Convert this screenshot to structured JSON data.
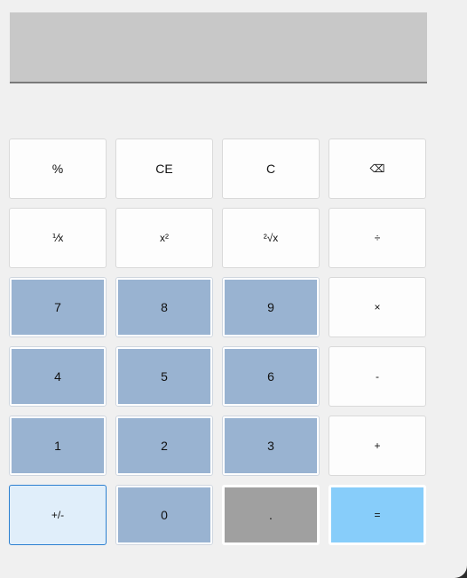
{
  "display": {
    "value": ""
  },
  "keys": [
    {
      "label": "%",
      "name": "percent-button"
    },
    {
      "label": "CE",
      "name": "clear-entry-button"
    },
    {
      "label": "C",
      "name": "clear-button"
    },
    {
      "label": "⌫",
      "name": "backspace-button",
      "icon": "backspace-icon"
    },
    {
      "label": "⅟x",
      "name": "reciprocal-button"
    },
    {
      "label": "x²",
      "name": "square-button"
    },
    {
      "label": "²√x",
      "name": "square-root-button"
    },
    {
      "label": "÷",
      "name": "divide-button"
    },
    {
      "label": "7",
      "name": "digit-7-button"
    },
    {
      "label": "8",
      "name": "digit-8-button"
    },
    {
      "label": "9",
      "name": "digit-9-button"
    },
    {
      "label": "×",
      "name": "multiply-button"
    },
    {
      "label": "4",
      "name": "digit-4-button"
    },
    {
      "label": "5",
      "name": "digit-5-button"
    },
    {
      "label": "6",
      "name": "digit-6-button"
    },
    {
      "label": "-",
      "name": "subtract-button"
    },
    {
      "label": "1",
      "name": "digit-1-button"
    },
    {
      "label": "2",
      "name": "digit-2-button"
    },
    {
      "label": "3",
      "name": "digit-3-button"
    },
    {
      "label": "+",
      "name": "add-button"
    },
    {
      "label": "+/-",
      "name": "negate-button"
    },
    {
      "label": "0",
      "name": "digit-0-button"
    },
    {
      "label": ".",
      "name": "decimal-button"
    },
    {
      "label": "=",
      "name": "equals-button"
    }
  ],
  "colors": {
    "window_bg": "#f0f0f0",
    "display_bg": "#c8c8c8",
    "function_key": "#fdfdfd",
    "number_key": "#99b3d1",
    "negate_key": "#e0eefa",
    "negate_border": "#2b7fd0",
    "decimal_key": "#a0a0a0",
    "equals_key": "#87cdfa"
  }
}
